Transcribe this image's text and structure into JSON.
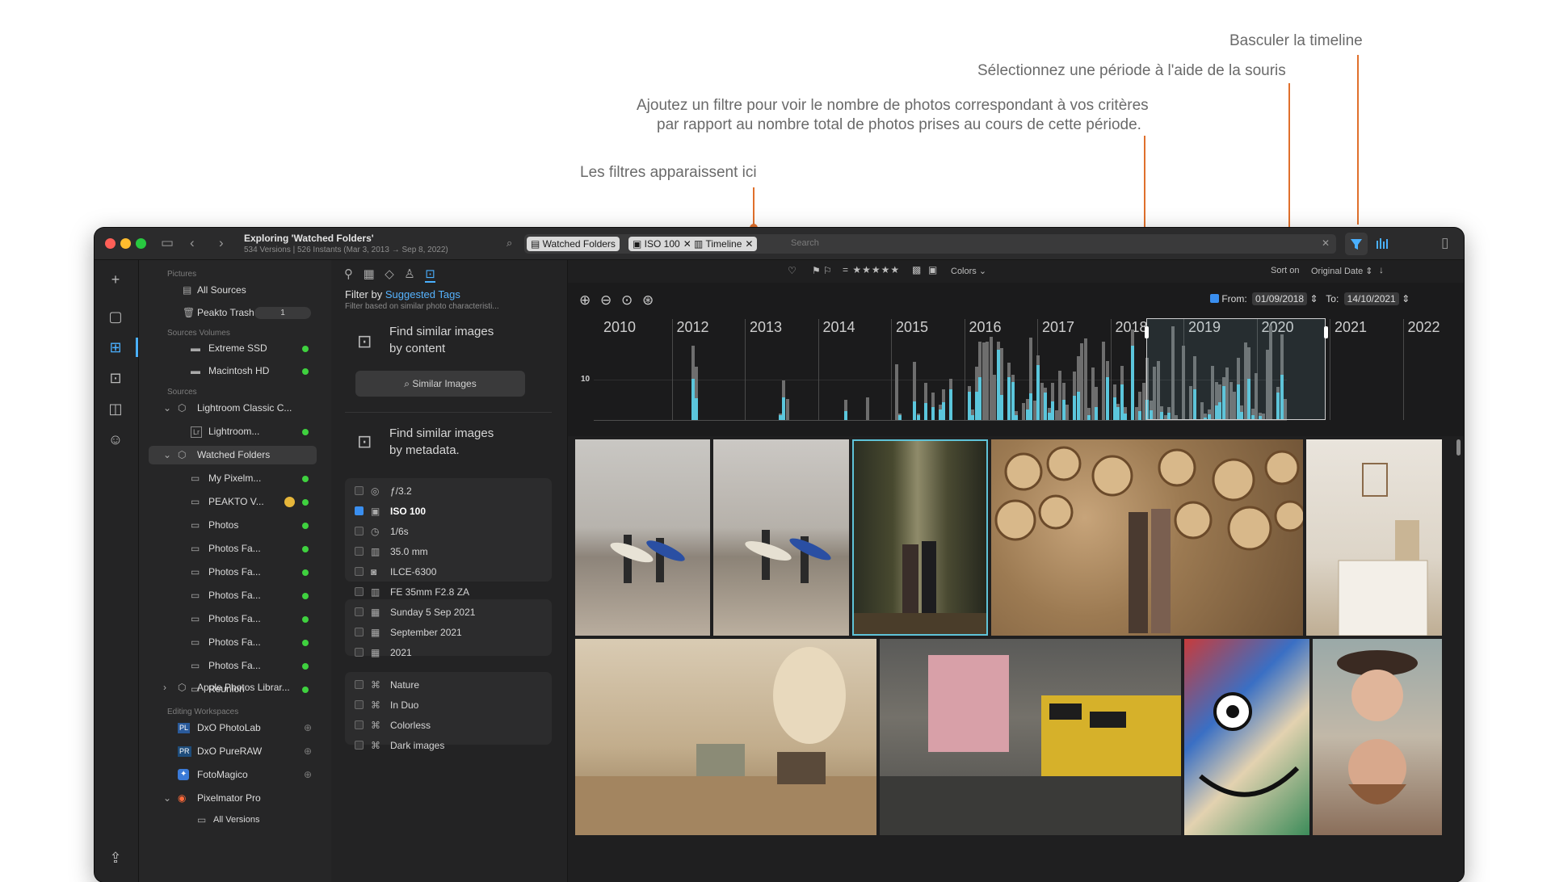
{
  "annotations": {
    "toggle_timeline": "Basculer la timeline",
    "select_period": "Sélectionnez une période à l'aide de la souris",
    "add_filter_line1": "Ajoutez un filtre pour voir le nombre de photos correspondant à vos critères",
    "add_filter_line2": "par rapport au nombre total de photos prises au cours de cette période.",
    "filters_here": "Les filtres apparaissent ici"
  },
  "window": {
    "title": "Exploring 'Watched Folders'",
    "subtitle": "534 Versions | 526 Instants (Mar 3, 2013 → Sep 8, 2022)"
  },
  "search": {
    "chips": [
      "Watched Folders",
      "ISO 100",
      "Timeline"
    ],
    "placeholder": "Search"
  },
  "sources": {
    "pictures_header": "Pictures",
    "all_sources": "All Sources",
    "trash": "Peakto Trash",
    "trash_count": "1",
    "volumes_header": "Sources Volumes",
    "volumes": [
      "Extreme SSD",
      "Macintosh HD"
    ],
    "sources_header": "Sources",
    "lightroom": "Lightroom Classic C...",
    "lightroom_child": "Lightroom...",
    "watched": "Watched Folders",
    "watched_children": [
      "My Pixelm...",
      "PEAKTO V...",
      "Photos",
      "Photos Fa...",
      "Photos Fa...",
      "Photos Fa...",
      "Photos Fa...",
      "Photos Fa...",
      "Photos Fa...",
      "Reunion"
    ],
    "apple": "Apple Photos Librar...",
    "editing_header": "Editing Workspaces",
    "editors": [
      "DxO PhotoLab",
      "DxO PureRAW",
      "FotoMagico",
      "Pixelmator Pro"
    ],
    "all_versions": "All Versions"
  },
  "filter": {
    "title_prefix": "Filter by",
    "title_link": "Suggested Tags",
    "subtitle": "Filter based on similar photo characteristi...",
    "find_content_1": "Find similar images",
    "find_content_2": "by content",
    "similar_btn": "Similar Images",
    "find_meta_1": "Find similar images",
    "find_meta_2": "by metadata.",
    "metadata": [
      "ƒ/3.2",
      "ISO 100",
      "1/6s",
      "35.0 mm",
      "ILCE-6300",
      "FE 35mm F2.8 ZA"
    ],
    "metadata_checked": [
      false,
      true,
      false,
      false,
      false,
      false
    ],
    "dates": [
      "Sunday 5 Sep 2021",
      "September 2021",
      "2021"
    ],
    "tags": [
      "Nature",
      "In Duo",
      "Colorless",
      "Dark images"
    ]
  },
  "toolbar": {
    "colors": "Colors",
    "sort_label": "Sort on",
    "sort_value": "Original Date"
  },
  "timeline": {
    "from_label": "From:",
    "from_value": "01/09/2018",
    "to_label": "To:",
    "to_value": "14/10/2021",
    "years": [
      "2010",
      "2012",
      "2013",
      "2014",
      "2015",
      "2016",
      "2017",
      "2018",
      "2019",
      "2020",
      "2021",
      "2022"
    ],
    "y_tick": "10"
  },
  "colors": {
    "accent_blue": "#3a8ff0",
    "timeline_cyan": "#5bc6dc",
    "annotation_orange": "#e0702c",
    "status_green": "#3fd13f"
  }
}
